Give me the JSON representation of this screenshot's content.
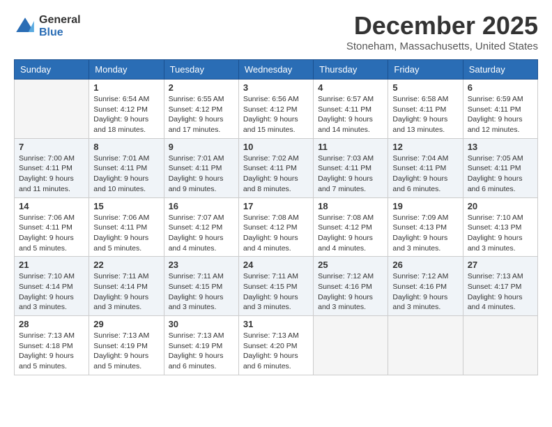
{
  "logo": {
    "general": "General",
    "blue": "Blue"
  },
  "title": "December 2025",
  "subtitle": "Stoneham, Massachusetts, United States",
  "days_of_week": [
    "Sunday",
    "Monday",
    "Tuesday",
    "Wednesday",
    "Thursday",
    "Friday",
    "Saturday"
  ],
  "weeks": [
    [
      {
        "num": "",
        "empty": true
      },
      {
        "num": "1",
        "sunrise": "Sunrise: 6:54 AM",
        "sunset": "Sunset: 4:12 PM",
        "daylight": "Daylight: 9 hours and 18 minutes."
      },
      {
        "num": "2",
        "sunrise": "Sunrise: 6:55 AM",
        "sunset": "Sunset: 4:12 PM",
        "daylight": "Daylight: 9 hours and 17 minutes."
      },
      {
        "num": "3",
        "sunrise": "Sunrise: 6:56 AM",
        "sunset": "Sunset: 4:12 PM",
        "daylight": "Daylight: 9 hours and 15 minutes."
      },
      {
        "num": "4",
        "sunrise": "Sunrise: 6:57 AM",
        "sunset": "Sunset: 4:11 PM",
        "daylight": "Daylight: 9 hours and 14 minutes."
      },
      {
        "num": "5",
        "sunrise": "Sunrise: 6:58 AM",
        "sunset": "Sunset: 4:11 PM",
        "daylight": "Daylight: 9 hours and 13 minutes."
      },
      {
        "num": "6",
        "sunrise": "Sunrise: 6:59 AM",
        "sunset": "Sunset: 4:11 PM",
        "daylight": "Daylight: 9 hours and 12 minutes."
      }
    ],
    [
      {
        "num": "7",
        "sunrise": "Sunrise: 7:00 AM",
        "sunset": "Sunset: 4:11 PM",
        "daylight": "Daylight: 9 hours and 11 minutes."
      },
      {
        "num": "8",
        "sunrise": "Sunrise: 7:01 AM",
        "sunset": "Sunset: 4:11 PM",
        "daylight": "Daylight: 9 hours and 10 minutes."
      },
      {
        "num": "9",
        "sunrise": "Sunrise: 7:01 AM",
        "sunset": "Sunset: 4:11 PM",
        "daylight": "Daylight: 9 hours and 9 minutes."
      },
      {
        "num": "10",
        "sunrise": "Sunrise: 7:02 AM",
        "sunset": "Sunset: 4:11 PM",
        "daylight": "Daylight: 9 hours and 8 minutes."
      },
      {
        "num": "11",
        "sunrise": "Sunrise: 7:03 AM",
        "sunset": "Sunset: 4:11 PM",
        "daylight": "Daylight: 9 hours and 7 minutes."
      },
      {
        "num": "12",
        "sunrise": "Sunrise: 7:04 AM",
        "sunset": "Sunset: 4:11 PM",
        "daylight": "Daylight: 9 hours and 6 minutes."
      },
      {
        "num": "13",
        "sunrise": "Sunrise: 7:05 AM",
        "sunset": "Sunset: 4:11 PM",
        "daylight": "Daylight: 9 hours and 6 minutes."
      }
    ],
    [
      {
        "num": "14",
        "sunrise": "Sunrise: 7:06 AM",
        "sunset": "Sunset: 4:11 PM",
        "daylight": "Daylight: 9 hours and 5 minutes."
      },
      {
        "num": "15",
        "sunrise": "Sunrise: 7:06 AM",
        "sunset": "Sunset: 4:11 PM",
        "daylight": "Daylight: 9 hours and 5 minutes."
      },
      {
        "num": "16",
        "sunrise": "Sunrise: 7:07 AM",
        "sunset": "Sunset: 4:12 PM",
        "daylight": "Daylight: 9 hours and 4 minutes."
      },
      {
        "num": "17",
        "sunrise": "Sunrise: 7:08 AM",
        "sunset": "Sunset: 4:12 PM",
        "daylight": "Daylight: 9 hours and 4 minutes."
      },
      {
        "num": "18",
        "sunrise": "Sunrise: 7:08 AM",
        "sunset": "Sunset: 4:12 PM",
        "daylight": "Daylight: 9 hours and 4 minutes."
      },
      {
        "num": "19",
        "sunrise": "Sunrise: 7:09 AM",
        "sunset": "Sunset: 4:13 PM",
        "daylight": "Daylight: 9 hours and 3 minutes."
      },
      {
        "num": "20",
        "sunrise": "Sunrise: 7:10 AM",
        "sunset": "Sunset: 4:13 PM",
        "daylight": "Daylight: 9 hours and 3 minutes."
      }
    ],
    [
      {
        "num": "21",
        "sunrise": "Sunrise: 7:10 AM",
        "sunset": "Sunset: 4:14 PM",
        "daylight": "Daylight: 9 hours and 3 minutes."
      },
      {
        "num": "22",
        "sunrise": "Sunrise: 7:11 AM",
        "sunset": "Sunset: 4:14 PM",
        "daylight": "Daylight: 9 hours and 3 minutes."
      },
      {
        "num": "23",
        "sunrise": "Sunrise: 7:11 AM",
        "sunset": "Sunset: 4:15 PM",
        "daylight": "Daylight: 9 hours and 3 minutes."
      },
      {
        "num": "24",
        "sunrise": "Sunrise: 7:11 AM",
        "sunset": "Sunset: 4:15 PM",
        "daylight": "Daylight: 9 hours and 3 minutes."
      },
      {
        "num": "25",
        "sunrise": "Sunrise: 7:12 AM",
        "sunset": "Sunset: 4:16 PM",
        "daylight": "Daylight: 9 hours and 3 minutes."
      },
      {
        "num": "26",
        "sunrise": "Sunrise: 7:12 AM",
        "sunset": "Sunset: 4:16 PM",
        "daylight": "Daylight: 9 hours and 3 minutes."
      },
      {
        "num": "27",
        "sunrise": "Sunrise: 7:13 AM",
        "sunset": "Sunset: 4:17 PM",
        "daylight": "Daylight: 9 hours and 4 minutes."
      }
    ],
    [
      {
        "num": "28",
        "sunrise": "Sunrise: 7:13 AM",
        "sunset": "Sunset: 4:18 PM",
        "daylight": "Daylight: 9 hours and 5 minutes."
      },
      {
        "num": "29",
        "sunrise": "Sunrise: 7:13 AM",
        "sunset": "Sunset: 4:19 PM",
        "daylight": "Daylight: 9 hours and 5 minutes."
      },
      {
        "num": "30",
        "sunrise": "Sunrise: 7:13 AM",
        "sunset": "Sunset: 4:19 PM",
        "daylight": "Daylight: 9 hours and 6 minutes."
      },
      {
        "num": "31",
        "sunrise": "Sunrise: 7:13 AM",
        "sunset": "Sunset: 4:20 PM",
        "daylight": "Daylight: 9 hours and 6 minutes."
      },
      {
        "num": "",
        "empty": true
      },
      {
        "num": "",
        "empty": true
      },
      {
        "num": "",
        "empty": true
      }
    ]
  ]
}
